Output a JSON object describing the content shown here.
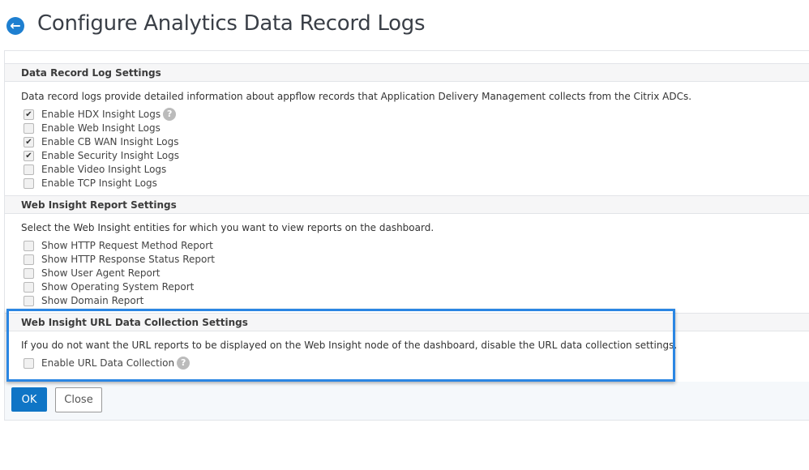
{
  "header": {
    "title": "Configure Analytics Data Record Logs",
    "back_icon": "arrow-left-circle-icon"
  },
  "colors": {
    "accent": "#0f75c6",
    "highlight": "#2b86e3"
  },
  "sections": [
    {
      "title": "Data Record Log Settings",
      "description": "Data record logs provide detailed information about appflow records that Application Delivery Management collects from the Citrix ADCs.",
      "items": [
        {
          "label": "Enable HDX Insight Logs",
          "checked": true,
          "help": true
        },
        {
          "label": "Enable Web Insight Logs",
          "checked": false
        },
        {
          "label": "Enable CB WAN Insight Logs",
          "checked": true
        },
        {
          "label": "Enable Security Insight Logs",
          "checked": true
        },
        {
          "label": "Enable Video Insight Logs",
          "checked": false
        },
        {
          "label": "Enable TCP Insight Logs",
          "checked": false
        }
      ]
    },
    {
      "title": "Web Insight Report Settings",
      "description": "Select the Web Insight entities for which you want to view reports on the dashboard.",
      "items": [
        {
          "label": "Show HTTP Request Method Report",
          "checked": false
        },
        {
          "label": "Show HTTP Response Status Report",
          "checked": false
        },
        {
          "label": "Show User Agent Report",
          "checked": false
        },
        {
          "label": "Show Operating System Report",
          "checked": false
        },
        {
          "label": "Show Domain Report",
          "checked": false
        }
      ]
    },
    {
      "title": "Web Insight URL Data Collection Settings",
      "description": "If you do not want the URL reports to be displayed on the Web Insight node of the dashboard, disable the URL data collection settings.",
      "items": [
        {
          "label": "Enable URL Data Collection",
          "checked": false,
          "help": true
        }
      ]
    }
  ],
  "help_glyph": "?",
  "check_glyph": "✔",
  "footer": {
    "ok_label": "OK",
    "close_label": "Close"
  }
}
